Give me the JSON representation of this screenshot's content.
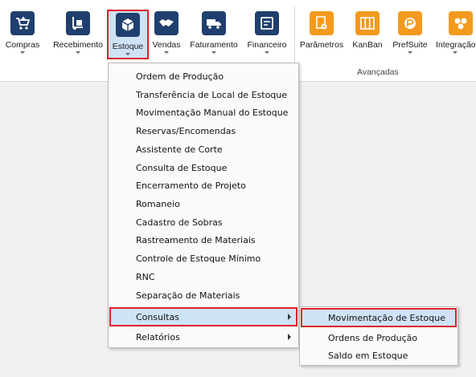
{
  "ribbon": {
    "buttons": [
      {
        "label": "Compras",
        "icon": "cart-icon"
      },
      {
        "label": "Recebimento",
        "icon": "hand-truck-icon"
      },
      {
        "label": "Estoque",
        "icon": "boxes-icon"
      },
      {
        "label": "Vendas",
        "icon": "handshake-icon"
      },
      {
        "label": "Faturamento",
        "icon": "delivery-truck-icon"
      },
      {
        "label": "Financeiro",
        "icon": "register-icon"
      },
      {
        "label": "Parâmetros",
        "icon": "settings-doc-icon"
      },
      {
        "label": "KanBan",
        "icon": "kanban-icon"
      },
      {
        "label": "PrefSuite",
        "icon": "prefsuite-icon"
      },
      {
        "label": "Integração",
        "icon": "integration-icon"
      }
    ],
    "group_label": "Avançadas",
    "colors": {
      "primary_icon": "#1f3f6e",
      "advanced_icon": "#f39a1d",
      "highlight": "#e0202a",
      "selected_bg": "#cfe3f7"
    }
  },
  "estoque_menu": {
    "items": [
      "Ordem de Produção",
      "Transferência de Local de Estoque",
      "Movimentação Manual do Estoque",
      "Reservas/Encomendas",
      "Assistente de Corte",
      "Consulta de Estoque",
      "Encerramento de Projeto",
      "Romaneio",
      "Cadastro de Sobras",
      "Rastreamento de Materiais",
      "Controle de Estoque Mínimo",
      "RNC",
      "Separação de Materiais",
      "Consultas",
      "Relatórios"
    ]
  },
  "consultas_menu": {
    "items": [
      "Movimentação de Estoque",
      "Ordens de Produção",
      "Saldo em Estoque"
    ]
  }
}
